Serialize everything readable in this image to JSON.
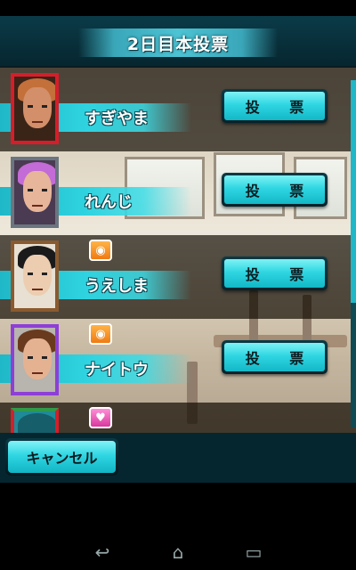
{
  "header": {
    "title": "2日目本投票"
  },
  "rows": [
    {
      "name": "すぎやま",
      "vote_label": "投 票",
      "frame_color": "#d81d2a",
      "hair_color": "#c4703a",
      "skin_color": "#d28f6a",
      "badge": null
    },
    {
      "name": "れんじ",
      "vote_label": "投 票",
      "frame_color": "#6b7580",
      "hair_color": "#c36bd6",
      "skin_color": "#e6b59a",
      "badge": null
    },
    {
      "name": "うえしま",
      "vote_label": "投 票",
      "frame_color": "#8a5a2e",
      "hair_color": "#1a1a1a",
      "skin_color": "#eccdb0",
      "badge": "eye-icon"
    },
    {
      "name": "ナイトウ",
      "vote_label": "投 票",
      "frame_color": "#8e3fd6",
      "hair_color": "#6a3a1e",
      "skin_color": "#e5b291",
      "badge": "eye-icon"
    },
    {
      "name": "",
      "vote_label": "",
      "frame_color": "#2f9a4a",
      "hair_color": "#155e6a",
      "skin_color": "#1f8a98",
      "badge": "heart-icon"
    }
  ],
  "footer": {
    "cancel_label": "キャンセル"
  },
  "navbar": {
    "back_icon": "back-icon",
    "home_icon": "home-icon",
    "recents_icon": "recents-icon"
  },
  "colors": {
    "accent": "#2fd6e2",
    "header_bg": "#0b3b48"
  }
}
